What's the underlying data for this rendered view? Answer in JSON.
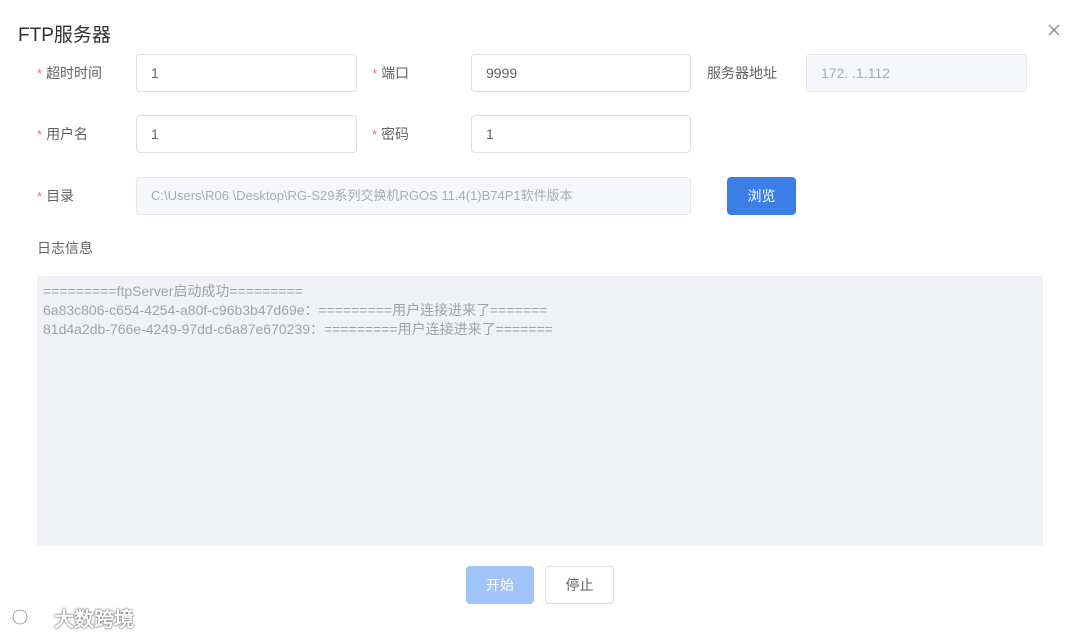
{
  "dialog": {
    "title": "FTP服务器",
    "close_icon": "close-icon"
  },
  "form": {
    "timeout": {
      "label": "超时时间",
      "value": "1",
      "required": true
    },
    "port": {
      "label": "端口",
      "value": "9999",
      "required": true
    },
    "server_address": {
      "label": "服务器地址",
      "value": "172.   .1.112",
      "disabled": true
    },
    "username": {
      "label": "用户名",
      "value": "1",
      "required": true
    },
    "password": {
      "label": "密码",
      "value": "1",
      "required": true
    },
    "directory": {
      "label": "目录",
      "value": "C:\\Users\\R06    \\Desktop\\RG-S29系列交换机RGOS 11.4(1)B74P1软件版本",
      "required": true,
      "disabled": true
    },
    "browse_label": "浏览",
    "required_mark": "*"
  },
  "log": {
    "label": "日志信息",
    "lines": [
      "=========ftpServer启动成功=========",
      "6a83c806-c654-4254-a80f-c96b3b47d69e：=========用户连接进来了=======",
      "81d4a2db-766e-4249-97dd-c6a87e670239：=========用户连接进来了======="
    ]
  },
  "footer": {
    "start_label": "开始",
    "stop_label": "停止"
  },
  "brand": {
    "text": "大数跨境",
    "icon": "brand-logo-icon"
  },
  "colors": {
    "primary": "#3a7ee6",
    "primary_disabled": "#a0c4f5",
    "required": "#f56c6c",
    "log_bg": "#f0f2f6"
  }
}
